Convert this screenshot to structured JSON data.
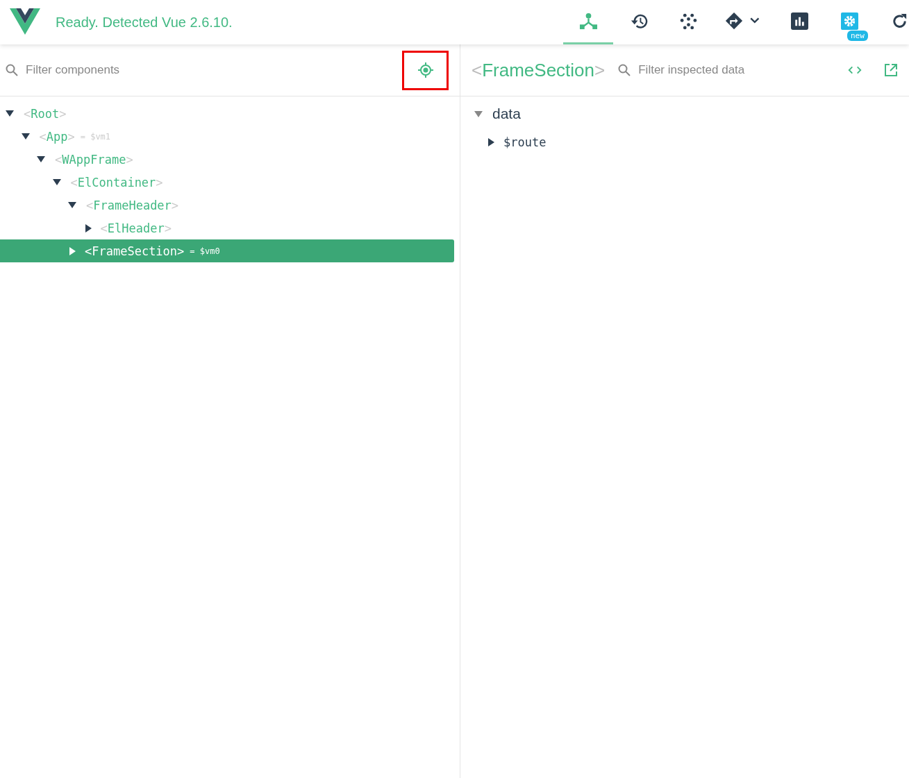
{
  "header": {
    "status": "Ready. Detected Vue 2.6.10.",
    "tabs": [
      {
        "kind": "components",
        "selected": true
      },
      {
        "kind": "history",
        "selected": false
      },
      {
        "kind": "dots",
        "selected": false
      },
      {
        "kind": "routing",
        "selected": false
      },
      {
        "kind": "chart",
        "selected": false
      },
      {
        "kind": "settings",
        "selected": false,
        "badge": "new"
      },
      {
        "kind": "refresh",
        "selected": false
      }
    ]
  },
  "left": {
    "search": {
      "placeholder": "Filter components"
    },
    "target_button": {
      "outlined": true
    },
    "tree": [
      {
        "label": "<Root>",
        "expanded": true,
        "selected": false,
        "children": [
          {
            "label": "<App>",
            "ref": "= $vm1",
            "expanded": true,
            "selected": false,
            "children": [
              {
                "label": "<WAppFrame>",
                "expanded": true,
                "selected": false,
                "children": [
                  {
                    "label": "<ElContainer>",
                    "expanded": true,
                    "selected": false,
                    "children": [
                      {
                        "label": "<FrameHeader>",
                        "expanded": true,
                        "selected": false,
                        "children": [
                          {
                            "label": "<ElHeader>",
                            "expanded": false,
                            "selected": false
                          }
                        ]
                      },
                      {
                        "label": "<FrameSection>",
                        "ref": "= $vm0",
                        "expanded": false,
                        "selected": true
                      }
                    ]
                  }
                ]
              }
            ]
          }
        ]
      }
    ]
  },
  "right": {
    "title": "<FrameSection>",
    "search": {
      "placeholder": "Filter inspected data"
    },
    "sections": [
      {
        "name": "data",
        "expanded": true,
        "items": [
          {
            "key": "$route",
            "expanded": false
          }
        ]
      }
    ]
  }
}
